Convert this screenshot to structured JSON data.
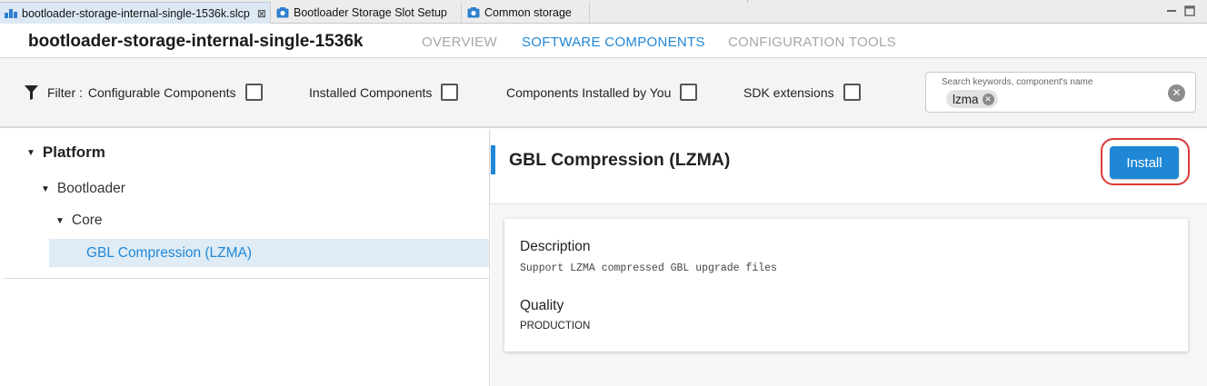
{
  "editor_tabs": [
    {
      "label": "bootloader-storage-internal-single-1536k.slcp",
      "icon": "project-icon",
      "active": true,
      "closable": true
    },
    {
      "label": "Bootloader Storage Slot Setup",
      "icon": "config-tool-icon",
      "active": false
    },
    {
      "label": "Common storage",
      "icon": "config-tool-icon",
      "active": false
    }
  ],
  "header": {
    "project_title": "bootloader-storage-internal-single-1536k",
    "tabs": [
      {
        "label": "OVERVIEW",
        "active": false
      },
      {
        "label": "SOFTWARE COMPONENTS",
        "active": true
      },
      {
        "label": "CONFIGURATION TOOLS",
        "active": false
      }
    ]
  },
  "filters": {
    "filter_label": "Filter :",
    "options": [
      {
        "label": "Configurable Components",
        "checked": false
      },
      {
        "label": "Installed Components",
        "checked": false
      },
      {
        "label": "Components Installed by You",
        "checked": false
      },
      {
        "label": "SDK extensions",
        "checked": false
      }
    ],
    "search": {
      "placeholder": "Search keywords, component's name",
      "chip": "lzma"
    }
  },
  "tree": {
    "items": [
      {
        "label": "Platform",
        "expanded": true,
        "level": 0
      },
      {
        "label": "Bootloader",
        "expanded": true,
        "level": 1
      },
      {
        "label": "Core",
        "expanded": true,
        "level": 2
      },
      {
        "label": "GBL Compression (LZMA)",
        "selected": true,
        "level": 3
      }
    ]
  },
  "detail": {
    "title": "GBL Compression (LZMA)",
    "install_label": "Install",
    "description_label": "Description",
    "description": "Support LZMA compressed GBL upgrade files",
    "quality_label": "Quality",
    "quality": "PRODUCTION"
  },
  "colors": {
    "accent": "#1f87d6",
    "highlight_ring": "#e0393a",
    "selected_row": "#dfecf6"
  }
}
